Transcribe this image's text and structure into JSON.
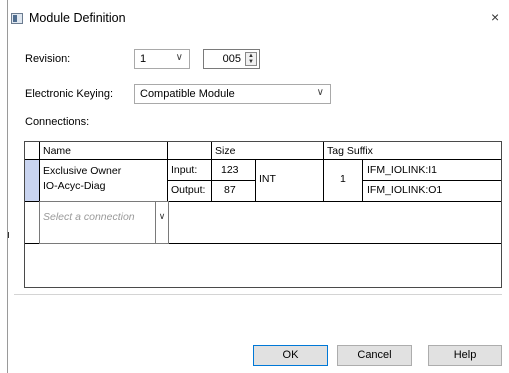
{
  "window": {
    "title": "Module Definition",
    "close_glyph": "×"
  },
  "revision": {
    "label": "Revision:",
    "major": "1",
    "minor": "005"
  },
  "keying": {
    "label": "Electronic Keying:",
    "value": "Compatible Module"
  },
  "connections": {
    "label": "Connections:",
    "headers": {
      "name": "Name",
      "size": "Size",
      "tag_suffix": "Tag Suffix"
    },
    "row": {
      "name_line1": "Exclusive Owner",
      "name_line2": "IO-Acyc-Diag",
      "input_label": "Input:",
      "output_label": "Output:",
      "input_size": "123",
      "output_size": "87",
      "type": "INT",
      "count": "1",
      "input_tag": "IFM_IOLINK:I1",
      "output_tag": "IFM_IOLINK:O1"
    },
    "select_placeholder": "Select a connection"
  },
  "buttons": {
    "ok": "OK",
    "cancel": "Cancel",
    "help": "Help"
  },
  "icons": {
    "title": "module-window-icon",
    "close": "close-icon",
    "dropdown": "chevron-down-icon",
    "spin": "spin-arrows-icon"
  },
  "colors": {
    "selection_bar": "#c9d4f0",
    "accent_border": "#0078d7"
  }
}
